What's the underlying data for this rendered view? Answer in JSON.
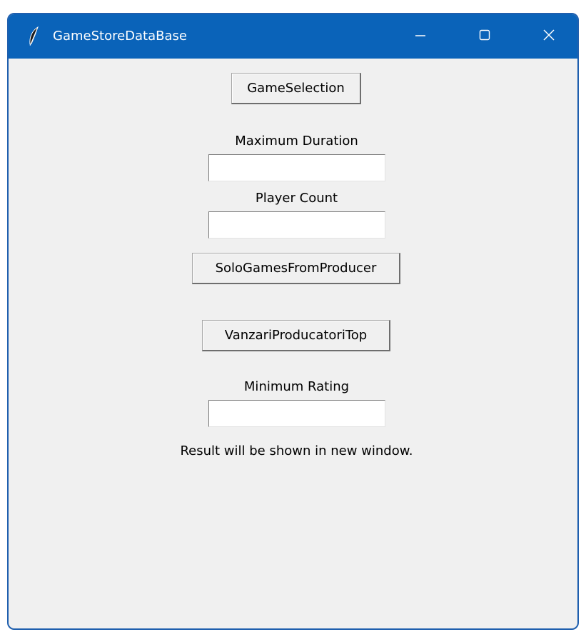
{
  "window": {
    "title": "GameStoreDataBase",
    "icon": "feather-icon",
    "controls": {
      "minimize_icon": "minimize-icon",
      "maximize_icon": "maximize-icon",
      "close_icon": "close-icon"
    },
    "accent_color": "#0a63b9",
    "background_color": "#f0f0f0"
  },
  "form": {
    "game_selection_button": "GameSelection",
    "max_duration_label": "Maximum Duration",
    "max_duration_value": "",
    "player_count_label": "Player Count",
    "player_count_value": "",
    "solo_games_button": "SoloGamesFromProducer",
    "top_producers_button": "VanzariProducatoriTop",
    "min_rating_label": "Minimum Rating",
    "min_rating_value": "",
    "result_message": "Result will be shown in new window."
  }
}
